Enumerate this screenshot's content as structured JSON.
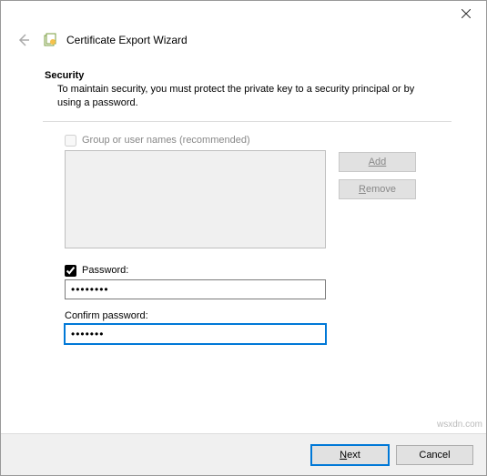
{
  "window": {
    "title": "Certificate Export Wizard"
  },
  "section": {
    "heading": "Security",
    "description": "To maintain security, you must protect the private key to a security principal or by using a password."
  },
  "groupNames": {
    "checkbox_label": "Group or user names (recommended)",
    "checked": false,
    "add_label": "Add",
    "remove_label": "Remove"
  },
  "password": {
    "checkbox_label": "Password:",
    "checked": true,
    "value": "••••••••",
    "confirm_label": "Confirm password:",
    "confirm_value": "•••••••"
  },
  "footer": {
    "next": "Next",
    "cancel": "Cancel"
  },
  "watermark": "wsxdn.com"
}
